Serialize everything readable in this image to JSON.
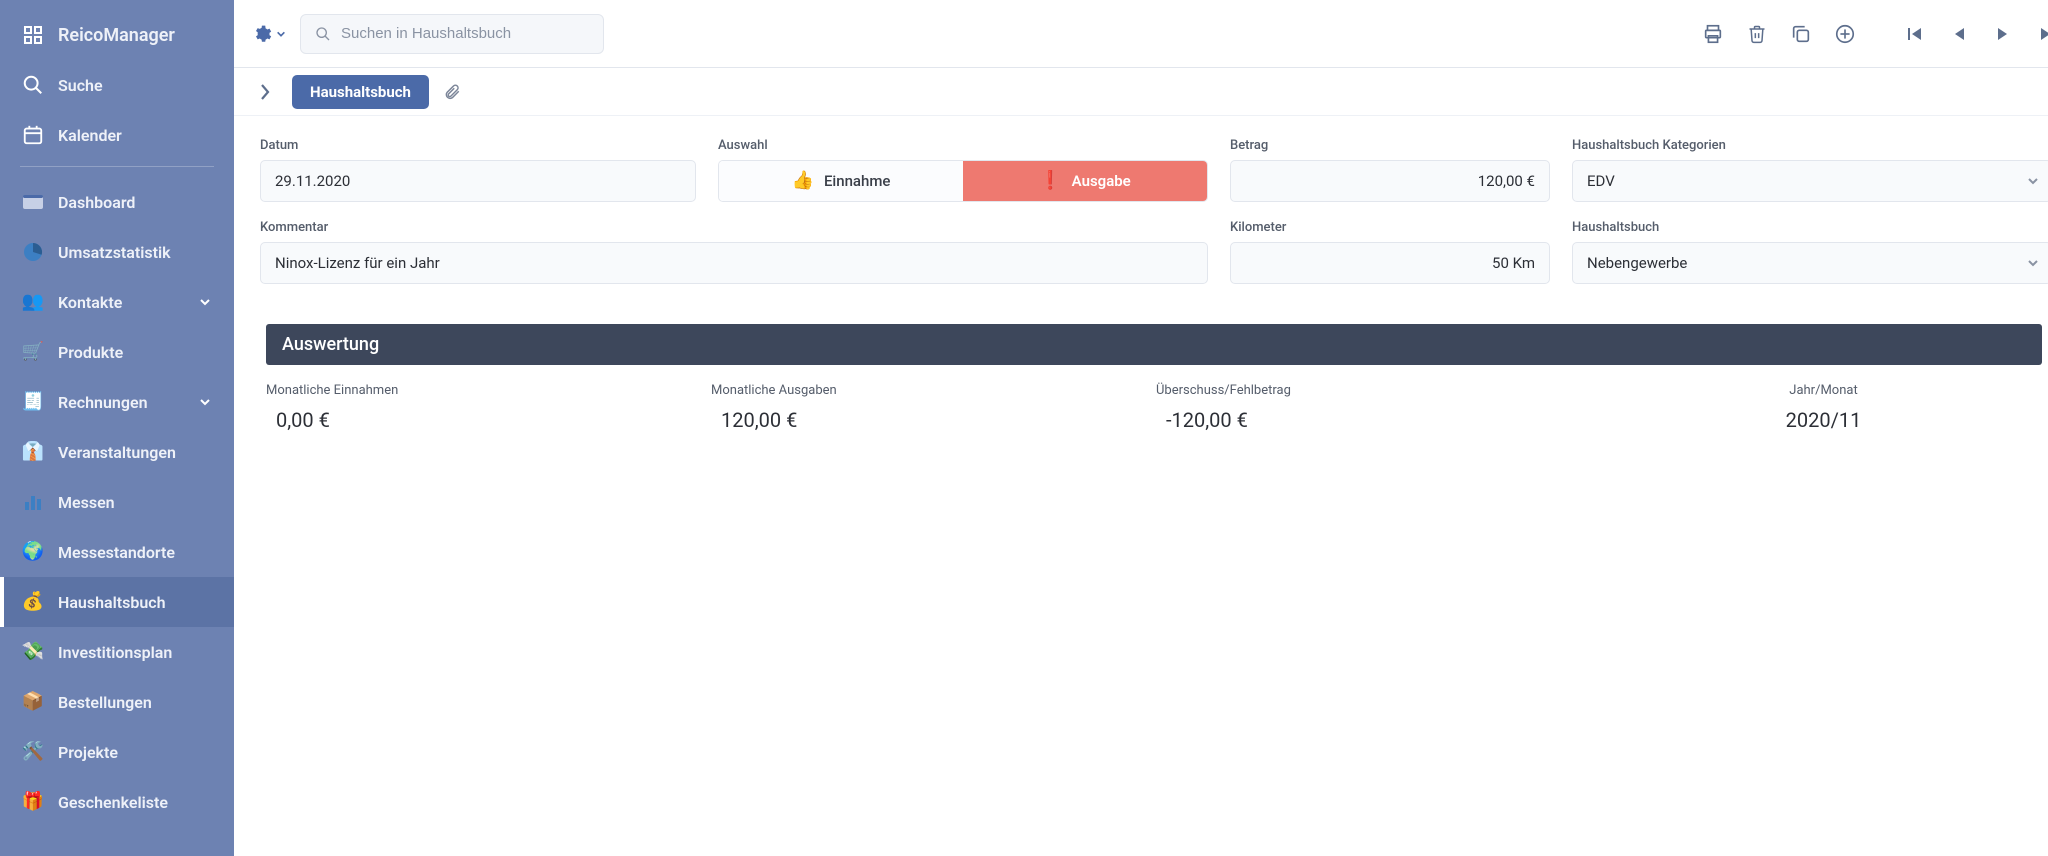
{
  "brand": "ReicoManager",
  "search": {
    "placeholder": "Suchen in Haushaltsbuch"
  },
  "sidebar": {
    "top": [
      {
        "label": "Suche"
      },
      {
        "label": "Kalender"
      }
    ],
    "items": [
      {
        "label": "Dashboard"
      },
      {
        "label": "Umsatzstatistik"
      },
      {
        "label": "Kontakte",
        "expandable": true
      },
      {
        "label": "Produkte"
      },
      {
        "label": "Rechnungen",
        "expandable": true
      },
      {
        "label": "Veranstaltungen"
      },
      {
        "label": "Messen"
      },
      {
        "label": "Messestandorte"
      },
      {
        "label": "Haushaltsbuch",
        "selected": true
      },
      {
        "label": "Investitionsplan"
      },
      {
        "label": "Bestellungen"
      },
      {
        "label": "Projekte"
      },
      {
        "label": "Geschenkeliste"
      }
    ]
  },
  "breadcrumb": {
    "current": "Haushaltsbuch"
  },
  "form": {
    "labels": {
      "datum": "Datum",
      "auswahl": "Auswahl",
      "betrag": "Betrag",
      "kategorien": "Haushaltsbuch Kategorien",
      "kommentar": "Kommentar",
      "kilometer": "Kilometer",
      "haushaltsbuch": "Haushaltsbuch"
    },
    "values": {
      "datum": "29.11.2020",
      "betrag": "120,00 €",
      "kategorie": "EDV",
      "kommentar": "Ninox-Lizenz für ein Jahr",
      "kilometer": "50 Km",
      "haushaltsbuch": "Nebengewerbe"
    },
    "toggle": {
      "einnahme": "Einnahme",
      "ausgabe": "Ausgabe",
      "active": "ausgabe"
    }
  },
  "evaluation": {
    "header": "Auswertung",
    "cols": [
      {
        "label": "Monatliche Einnahmen",
        "value": "0,00 €"
      },
      {
        "label": "Monatliche Ausgaben",
        "value": "120,00 €"
      },
      {
        "label": "Überschuss/Fehlbetrag",
        "value": "-120,00 €"
      },
      {
        "label": "Jahr/Monat",
        "value": "2020/11"
      }
    ]
  }
}
